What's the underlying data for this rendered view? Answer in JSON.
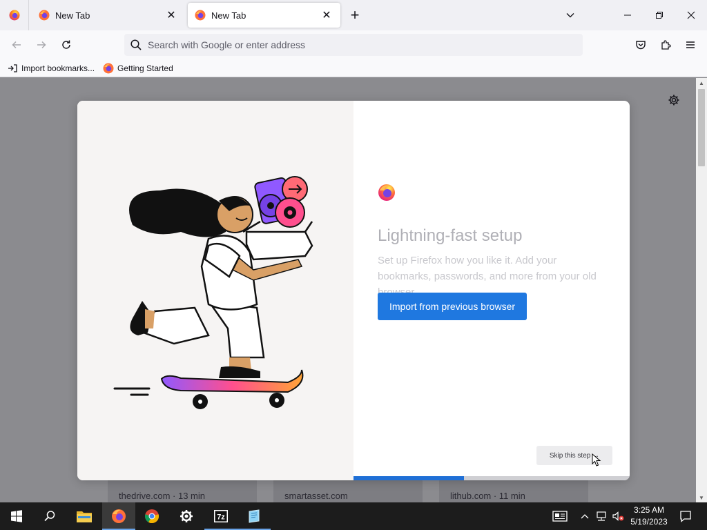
{
  "window": {
    "tabs": [
      {
        "label": "New Tab",
        "close": "✕",
        "favicon": "firefox-icon"
      },
      {
        "label": "New Tab",
        "close": "✕",
        "favicon": "firefox-icon",
        "active": true
      }
    ],
    "new_tab": "+"
  },
  "navbar": {
    "placeholder": "Search with Google or enter address"
  },
  "bookmarks": [
    {
      "label": "Import bookmarks...",
      "icon": "import-icon"
    },
    {
      "label": "Getting Started",
      "icon": "firefox-icon"
    }
  ],
  "newtab": {
    "tiles": [
      {
        "label": "thedrive.com · 13 min"
      },
      {
        "label": "smartasset.com"
      },
      {
        "label": "lithub.com · 11 min"
      }
    ]
  },
  "onboarding": {
    "title": "Lightning-fast setup",
    "subtitle": "Set up Firefox how you like it. Add your bookmarks, passwords, and more from your old browser.",
    "primary_button": "Import from previous browser",
    "skip_button": "Skip this step →",
    "progress": 0.4
  },
  "taskbar": {
    "apps": [
      "start-icon",
      "search-icon",
      "file-explorer-icon",
      "firefox-icon",
      "chrome-icon",
      "settings-icon",
      "7zip-icon",
      "notepad-icon"
    ],
    "clock_time": "3:25 AM",
    "clock_date": "5/19/2023"
  },
  "colors": {
    "accent": "#1f78e0",
    "progress": "#1f6fd6",
    "overlay": "#8b8b8f"
  }
}
